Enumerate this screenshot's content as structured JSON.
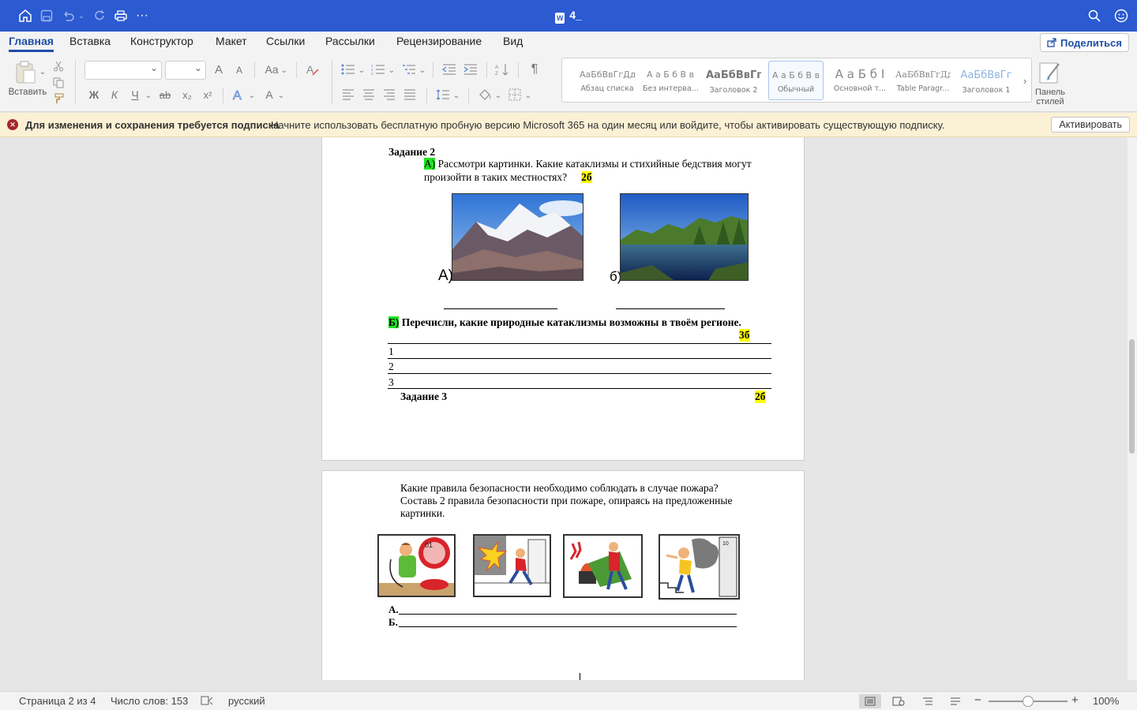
{
  "titlebar": {
    "title": "4_",
    "doc_icon": "W"
  },
  "tabs": [
    "Главная",
    "Вставка",
    "Конструктор",
    "Макет",
    "Ссылки",
    "Рассылки",
    "Рецензирование",
    "Вид"
  ],
  "share_label": "Поделиться",
  "ribbon": {
    "paste_label": "Вставить",
    "bold": "Ж",
    "italic": "К",
    "underline": "Ч",
    "strike": "ab",
    "sub": "x₂",
    "sup": "x²",
    "case": "Aa",
    "grow": "A",
    "shrink": "A",
    "styles_pane_label1": "Панель",
    "styles_pane_label2": "стилей",
    "styles": [
      {
        "sample": "АаБбВвГгДд",
        "name": "Абзац списка"
      },
      {
        "sample": "А а Б б В в",
        "name": "Без интерва..."
      },
      {
        "sample": "АаБбВвГг",
        "name": "Заголовок 2"
      },
      {
        "sample": "А а Б б В в",
        "name": "Обычный"
      },
      {
        "sample": "А а Б б I",
        "name": "Основной т..."
      },
      {
        "sample": "АаБбВвГгДд",
        "name": "Table Paragr..."
      },
      {
        "sample": "АаБбВвГг",
        "name": "Заголовок 1"
      }
    ]
  },
  "notification": {
    "bold_text": "Для изменения и сохранения требуется подписка",
    "message": "Начните использовать бесплатную пробную версию Microsoft 365 на один месяц или войдите, чтобы активировать существующую подписку.",
    "button": "Активировать"
  },
  "doc": {
    "task2_title": "Задание 2",
    "a_marker": "А)",
    "a_text1": " Рассмотри картинки. Какие катаклизмы и стихийные бедствия могут",
    "a_text2": "произойти в таких местностях?",
    "a_points": "2б",
    "img_label_a": "А)",
    "img_label_b": "б)",
    "b_marker": "Б)",
    "b_text": " Перечисли, какие природные  катаклизмы возможны в твоём регионе.",
    "b_points": "3б",
    "rows": [
      "1",
      "2",
      "3"
    ],
    "task3_title": "Задание 3",
    "task3_points": "2б",
    "p2_text1": "Какие правила безопасности необходимо соблюдать в случае пожара?",
    "p2_text2": "Составь 2 правила безопасности при пожаре, опираясь на предложенные",
    "p2_text3": "картинки.",
    "answer_a": "А.",
    "answer_b": "Б.",
    "picture_badge": "01",
    "door_number": "10"
  },
  "status": {
    "page": "Страница 2 из 4",
    "words": "Число слов: 153",
    "language": "русский",
    "zoom": "100%",
    "zoom_level_percent": 100
  }
}
